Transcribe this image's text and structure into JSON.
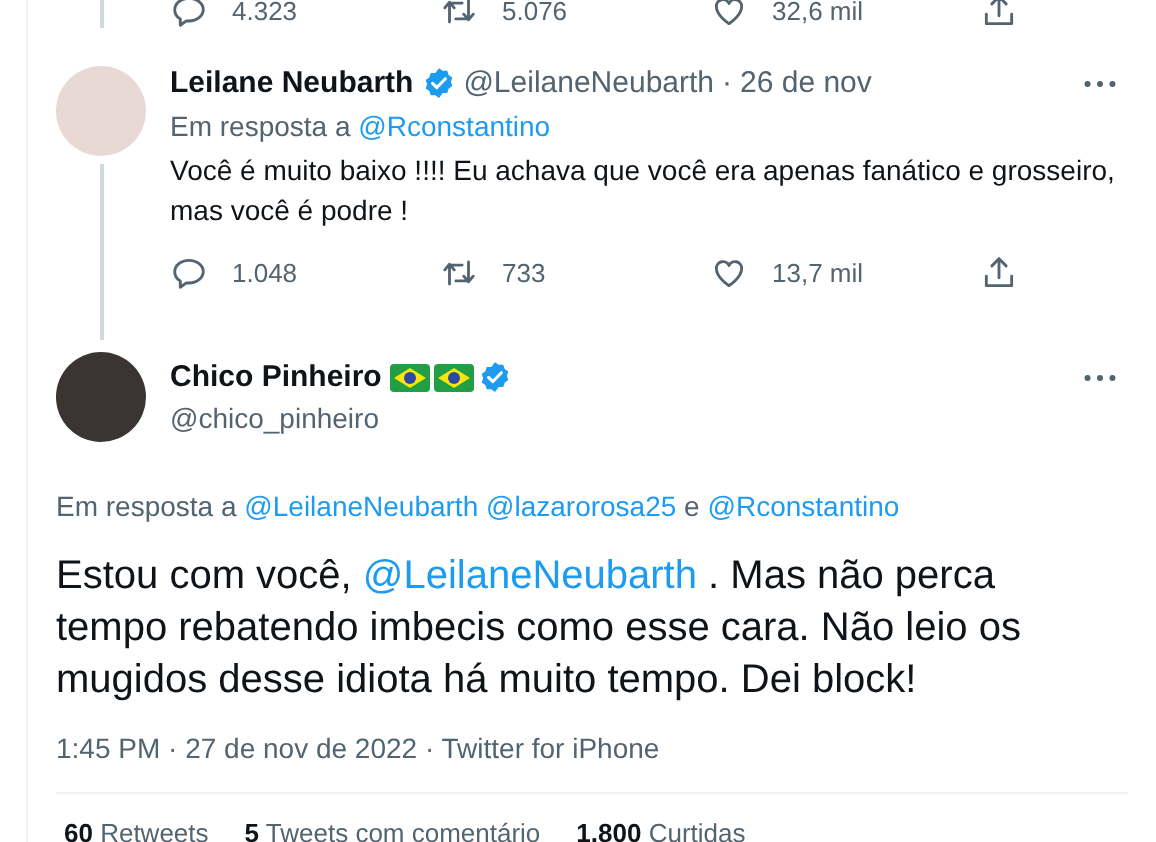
{
  "previous_tweet": {
    "actions": [
      {
        "kind": "reply",
        "count": "4.323"
      },
      {
        "kind": "retweet",
        "count": "5.076"
      },
      {
        "kind": "like",
        "count": "32,6 mil"
      },
      {
        "kind": "share"
      }
    ]
  },
  "reply": {
    "name": "Leilane Neubarth",
    "badges": [
      {
        "kind": "verified"
      }
    ],
    "handle": "@LeilaneNeubarth",
    "separator": "·",
    "date": "26 de nov",
    "reply_to_label": "Em resposta a",
    "reply_to": [
      "@Rconstantino"
    ],
    "text": "Você é muito baixo !!!! Eu achava que você era apenas fanático e grosseiro, mas você é podre !",
    "actions": [
      {
        "kind": "reply",
        "count": "1.048"
      },
      {
        "kind": "retweet",
        "count": "733"
      },
      {
        "kind": "like",
        "count": "13,7 mil"
      },
      {
        "kind": "share"
      }
    ]
  },
  "main_tweet": {
    "name": "Chico Pinheiro",
    "badges": [
      {
        "kind": "flag"
      },
      {
        "kind": "flag"
      },
      {
        "kind": "verified"
      }
    ],
    "handle": "@chico_pinheiro",
    "reply_to_label": "Em resposta a",
    "reply_to": [
      "@LeilaneNeubarth",
      "@lazarorosa25",
      "@Rconstantino"
    ],
    "reply_to_joiner": "e",
    "body": [
      {
        "kind": "text",
        "text": "Estou com você, "
      },
      {
        "kind": "mention",
        "text": "@LeilaneNeubarth"
      },
      {
        "kind": "text",
        "text": " . Mas não perca tempo rebatendo imbecis como esse cara. Não leio os mugidos desse idiota há muito tempo. Dei block!"
      }
    ],
    "meta": "1:45 PM · 27 de nov de 2022 · Twitter for iPhone",
    "stats": [
      {
        "count": "60",
        "label": "Retweets"
      },
      {
        "count": "5",
        "label": "Tweets com comentário"
      },
      {
        "count": "1.800",
        "label": "Curtidas"
      }
    ]
  }
}
